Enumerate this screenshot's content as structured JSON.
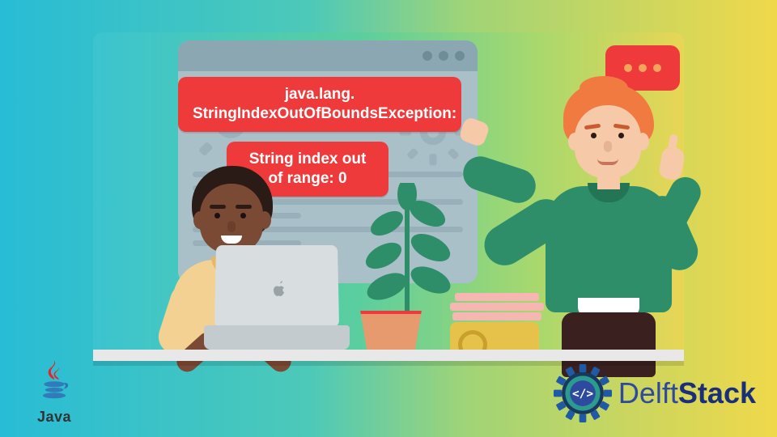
{
  "error": {
    "line1": "java.lang.",
    "line2": "StringIndexOutOfBoundsException:",
    "line3": "String index out",
    "line4": "of range: 0"
  },
  "logos": {
    "java": "Java",
    "delft_prefix": "Delft",
    "delft_suffix": "Stack"
  },
  "colors": {
    "error_bg": "#ef3a3b",
    "sweater": "#2e8e6a",
    "shirt": "#f3d193",
    "hair2": "#f07a40"
  }
}
